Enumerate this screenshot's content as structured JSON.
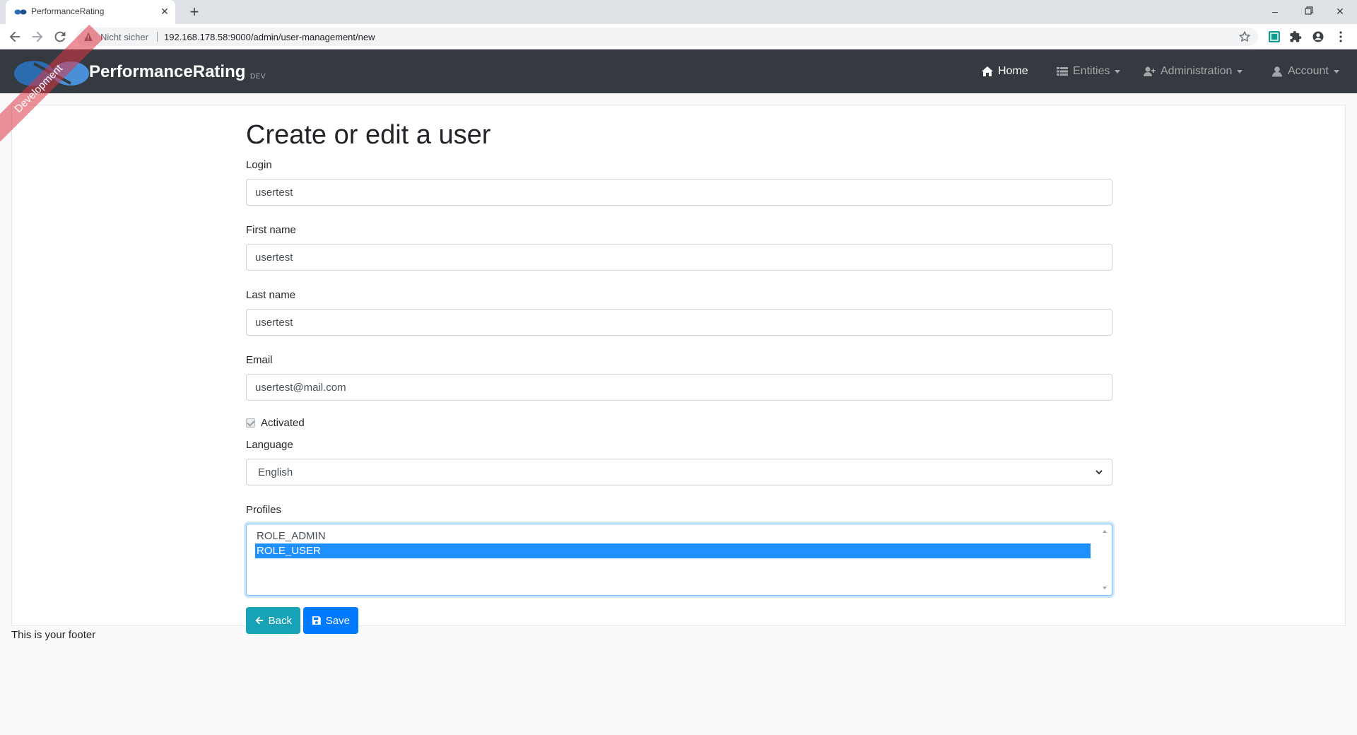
{
  "browser": {
    "tab_title": "PerformanceRating",
    "security_label": "Nicht sicher",
    "url": "192.168.178.58:9000/admin/user-management/new"
  },
  "app": {
    "brand": "PerformanceRating",
    "version": "DEV",
    "ribbon": "Development"
  },
  "nav": {
    "home": "Home",
    "entities": "Entities",
    "administration": "Administration",
    "account": "Account"
  },
  "form": {
    "title": "Create or edit a user",
    "login_label": "Login",
    "login_value": "usertest",
    "first_name_label": "First name",
    "first_name_value": "usertest",
    "last_name_label": "Last name",
    "last_name_value": "usertest",
    "email_label": "Email",
    "email_value": "usertest@mail.com",
    "activated_label": "Activated",
    "language_label": "Language",
    "language_value": "English",
    "profiles_label": "Profiles",
    "profiles": [
      {
        "label": "ROLE_ADMIN",
        "selected": false
      },
      {
        "label": "ROLE_USER",
        "selected": true
      }
    ],
    "back_label": "Back",
    "save_label": "Save"
  },
  "footer": "This is your footer",
  "colors": {
    "navbar": "#343a40",
    "back_button": "#17a2b8",
    "save_button": "#007bff",
    "selected_option": "#1e90ff",
    "ribbon": "#dc3545"
  }
}
